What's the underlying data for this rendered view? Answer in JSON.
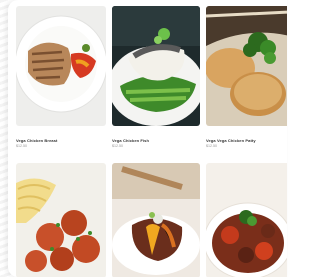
{
  "menu": {
    "items": [
      {
        "name": "Vega Chicken Breast",
        "price": "$12.50",
        "image_icon": "grilled-chicken-plate-photo"
      },
      {
        "name": "Vega Chicken Fish",
        "price": "$12.50",
        "image_icon": "fish-fillet-greens-photo"
      },
      {
        "name": "Vega Vega Chicken Patty",
        "price": "$12.50",
        "image_icon": "patty-with-salad-photo"
      },
      {
        "name": "",
        "price": "",
        "image_icon": "pasta-meatballs-photo"
      },
      {
        "name": "",
        "price": "",
        "image_icon": "braised-meat-plate-photo"
      },
      {
        "name": "",
        "price": "",
        "image_icon": "stew-bowl-photo"
      }
    ]
  }
}
